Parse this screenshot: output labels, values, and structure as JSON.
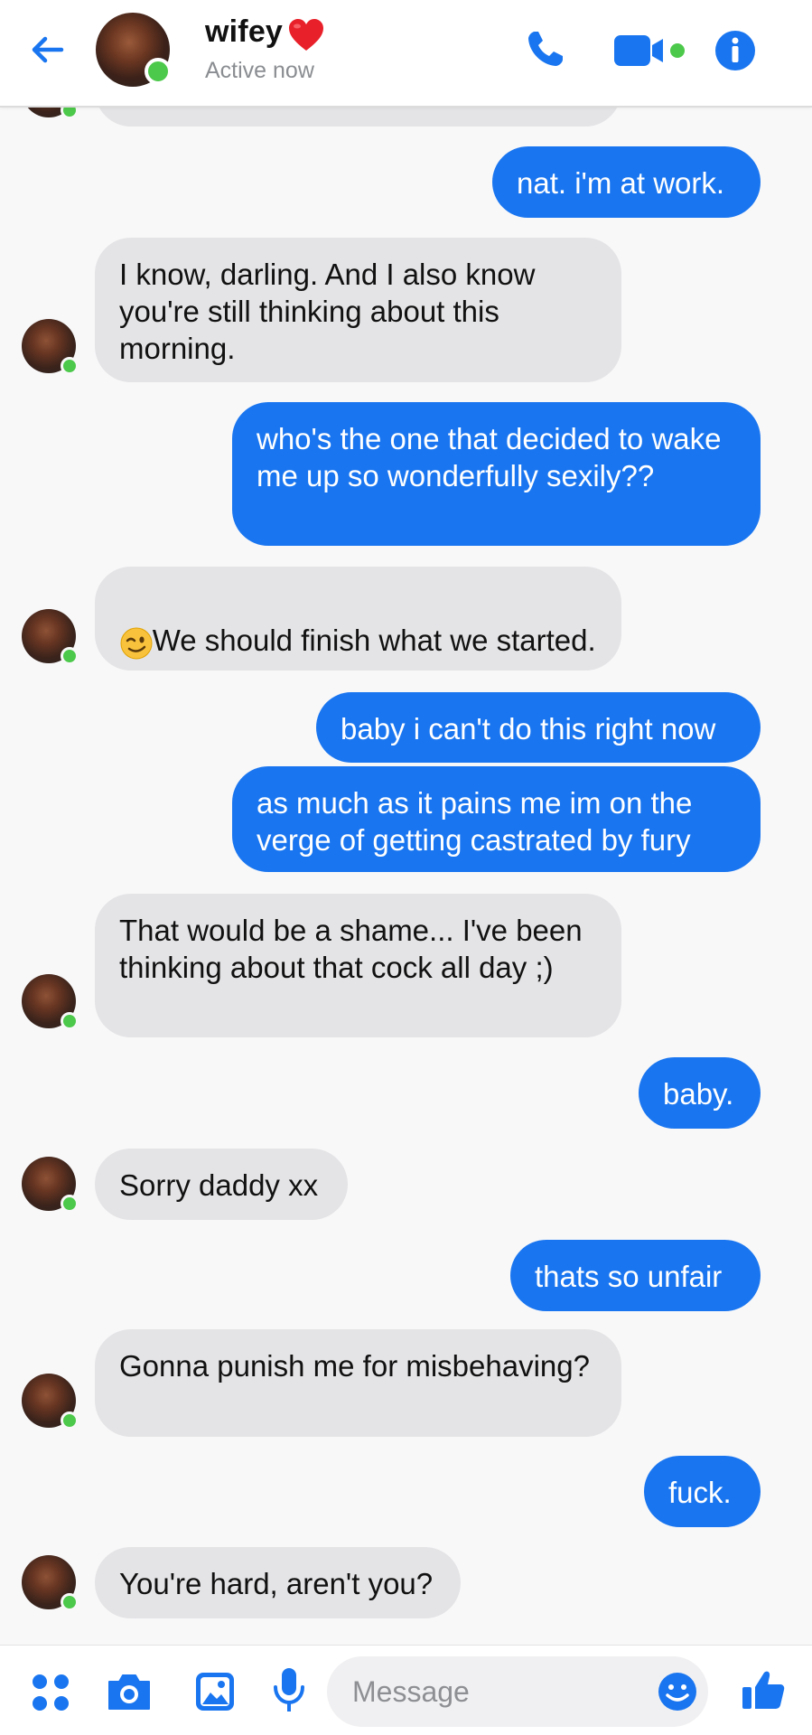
{
  "header": {
    "contact_name": "wifey",
    "status": "Active now",
    "icons": [
      "back-arrow-icon",
      "heart-emoji",
      "phone-icon",
      "video-camera-icon",
      "info-icon"
    ],
    "accent_color": "#1a76f0",
    "online_color": "#4cc84a"
  },
  "messages": [
    {
      "sender": "me",
      "text": "nat. i'm at work."
    },
    {
      "sender": "them",
      "text": "I know, darling. And I also know you're still thinking about this morning."
    },
    {
      "sender": "me",
      "text": "who's the one that decided to wake me up so wonderfully sexily??"
    },
    {
      "sender": "them",
      "text": "We should finish what we started."
    },
    {
      "sender": "me",
      "text": "baby i can't do this right now"
    },
    {
      "sender": "me",
      "text": "as much as it pains me im on the verge of getting castrated by fury"
    },
    {
      "sender": "them",
      "text": "That would be a shame... I've been thinking about that cock all day ;)"
    },
    {
      "sender": "me",
      "text": "baby."
    },
    {
      "sender": "them",
      "text": "Sorry daddy xx"
    },
    {
      "sender": "me",
      "text": "thats so unfair"
    },
    {
      "sender": "them",
      "text": "Gonna punish me for misbehaving?"
    },
    {
      "sender": "me",
      "text": "fuck."
    },
    {
      "sender": "them",
      "text": "You're hard, aren't you?"
    }
  ],
  "composer": {
    "placeholder": "Message",
    "icons": [
      "apps-icon",
      "camera-icon",
      "gallery-icon",
      "microphone-icon",
      "emoji-icon",
      "thumbs-up-icon"
    ]
  }
}
